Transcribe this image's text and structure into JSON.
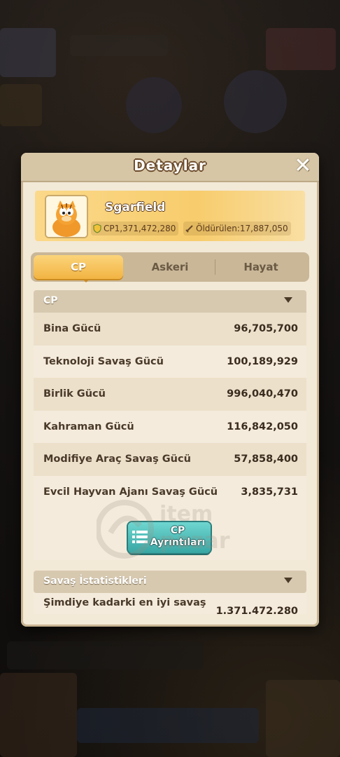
{
  "dialog": {
    "title": "Detaylar",
    "close_icon": "close-icon"
  },
  "profile": {
    "name": "Sgarfield",
    "cp": "CP1,371,472,280",
    "kills": "Öldürülen:17,887,050"
  },
  "tabs": [
    {
      "label": "CP",
      "active": true
    },
    {
      "label": "Askeri",
      "active": false
    },
    {
      "label": "Hayat",
      "active": false
    }
  ],
  "cp_section": {
    "title": "CP",
    "rows": [
      {
        "label": "Bina Gücü",
        "value": "96,705,700"
      },
      {
        "label": "Teknoloji Savaş Gücü",
        "value": "100,189,929"
      },
      {
        "label": "Birlik Gücü",
        "value": "996,040,470"
      },
      {
        "label": "Kahraman Gücü",
        "value": "116,842,050"
      },
      {
        "label": "Modifiye Araç Savaş Gücü",
        "value": "57,858,400"
      },
      {
        "label": "Evcil Hayvan Ajanı Savaş Gücü",
        "value": "3,835,731"
      }
    ],
    "detail_button_line1": "CP",
    "detail_button_line2": "Ayrıntıları"
  },
  "battle_section": {
    "title": "Savaş İstatistikleri",
    "rows": [
      {
        "label": "Şimdiye kadarki en iyi savaş",
        "value": "1,371,472,280"
      }
    ]
  },
  "watermark": {
    "line1": "item",
    "line2": "pazar"
  },
  "colors": {
    "accent_gold": "#f2b443",
    "button_teal": "#38a6a4",
    "panel_bg": "#f3e9d7"
  }
}
